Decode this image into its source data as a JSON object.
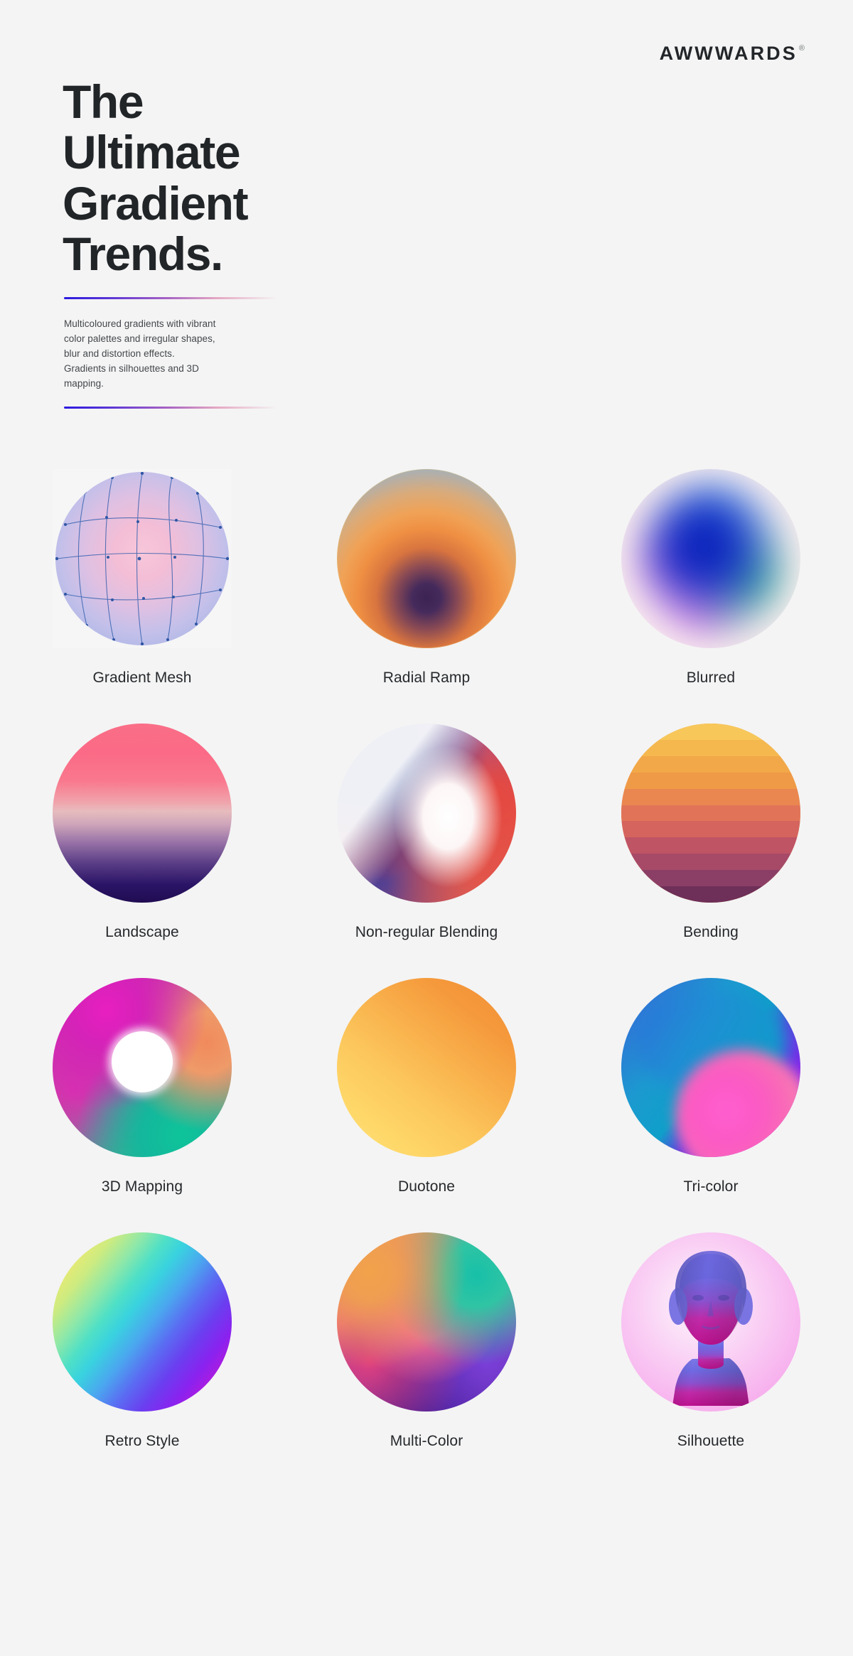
{
  "brand": {
    "name": "AWWWARDS",
    "registered": "®"
  },
  "header": {
    "title": "The\nUltimate\nGradient\nTrends.",
    "description": "Multicoloured gradients with vibrant\ncolor palettes and irregular shapes,\nblur and distortion effects.\nGradients in silhouettes and 3D\nmapping."
  },
  "theme": {
    "background": "#f4f4f4",
    "text_dark": "#212528",
    "text_body": "#43474b",
    "rule_start": "#2b1ae0",
    "rule_mid": "#a661c4",
    "rule_end": "#e5a8c2"
  },
  "swatches": [
    {
      "label": "Gradient Mesh",
      "style": "mesh",
      "colors": [
        "#f7c6d9",
        "#dfc0e2",
        "#adb6e6",
        "#3a63b0"
      ]
    },
    {
      "label": "Radial Ramp",
      "style": "radial",
      "colors": [
        "#3b2352",
        "#d8743f",
        "#f0a256",
        "#87a8c2"
      ]
    },
    {
      "label": "Blurred",
      "style": "blurred",
      "colors": [
        "#fbeff0",
        "#0d27c4",
        "#3ba2f0",
        "#d667e8",
        "#12998f"
      ]
    },
    {
      "label": "Landscape",
      "style": "landscape",
      "colors": [
        "#fa6e87",
        "#e7bcbe",
        "#5a3d86",
        "#200c52"
      ]
    },
    {
      "label": "Non-regular Blending",
      "style": "nonregular",
      "colors": [
        "#233a86",
        "#e03535",
        "#ffffff",
        "#e6483f"
      ]
    },
    {
      "label": "Bending",
      "style": "bending",
      "colors": [
        "#f6c košer"
      ],
      "bands": [
        "#f7c75a",
        "#f5b84f",
        "#f2a848",
        "#ef9a47",
        "#ea8650",
        "#e17458",
        "#d5645e",
        "#bf5465",
        "#a64a68",
        "#8c3f66",
        "#6e2f58"
      ]
    },
    {
      "label": "3D Mapping",
      "style": "torus",
      "colors": [
        "#e81fc0",
        "#f08a5c",
        "#0ec49a",
        "#ffffff"
      ]
    },
    {
      "label": "Duotone",
      "style": "duotone",
      "colors": [
        "#ffe27a",
        "#f28b33"
      ]
    },
    {
      "label": "Tri-color",
      "style": "tricolor",
      "colors": [
        "#0f9fc9",
        "#a614f2",
        "#ff5fd0"
      ]
    },
    {
      "label": "Retro Style",
      "style": "retro",
      "colors": [
        "#f6e96a",
        "#4fe0c6",
        "#5a6df2",
        "#f0177f"
      ]
    },
    {
      "label": "Multi-Color",
      "style": "multicolor",
      "colors": [
        "#f2a24a",
        "#17c0a8",
        "#f2638c",
        "#3a1a8e"
      ]
    },
    {
      "label": "Silhouette",
      "style": "silhouette",
      "colors": [
        "#f9c9f3",
        "#6b6be0",
        "#c0189a"
      ]
    }
  ]
}
